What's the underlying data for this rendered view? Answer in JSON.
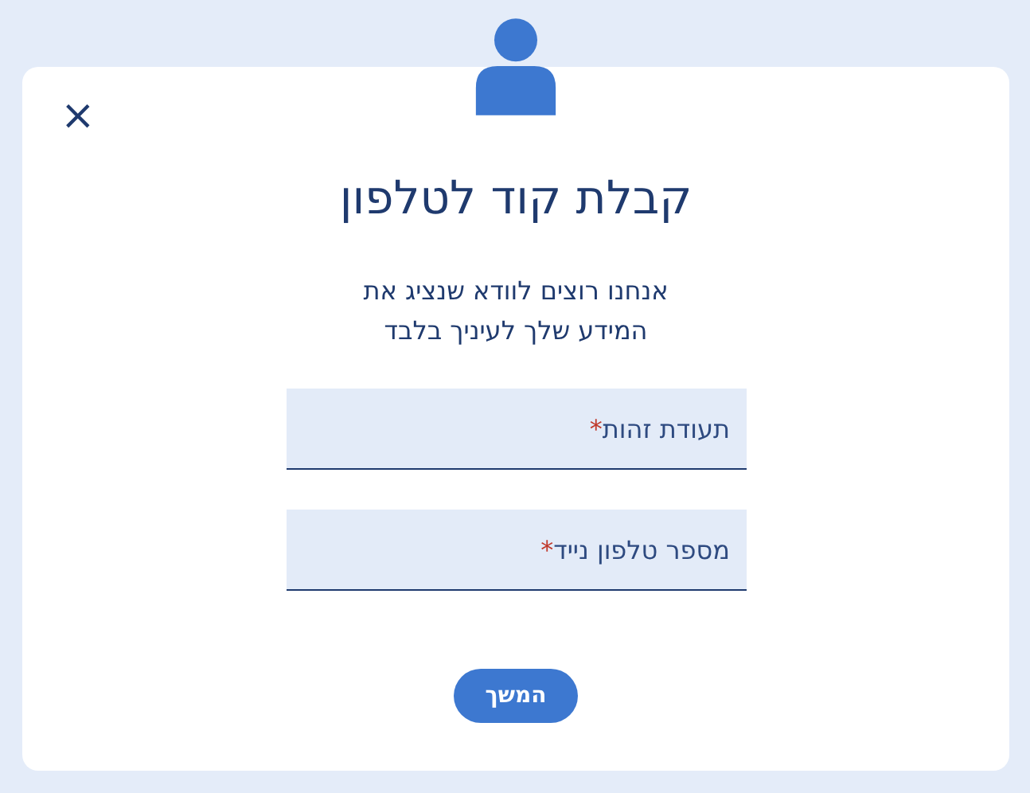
{
  "dialog": {
    "close": "×",
    "title": "קבלת קוד לטלפון",
    "description_lines": [
      "אנחנו רוצים לוודא שנציג את",
      "המידע שלך לעיניך בלבד"
    ],
    "fields": [
      {
        "label": "תעודת זהות",
        "required_mark": "*"
      },
      {
        "label": "מספר טלפון נייד",
        "required_mark": "*"
      }
    ],
    "button": "המשך"
  }
}
